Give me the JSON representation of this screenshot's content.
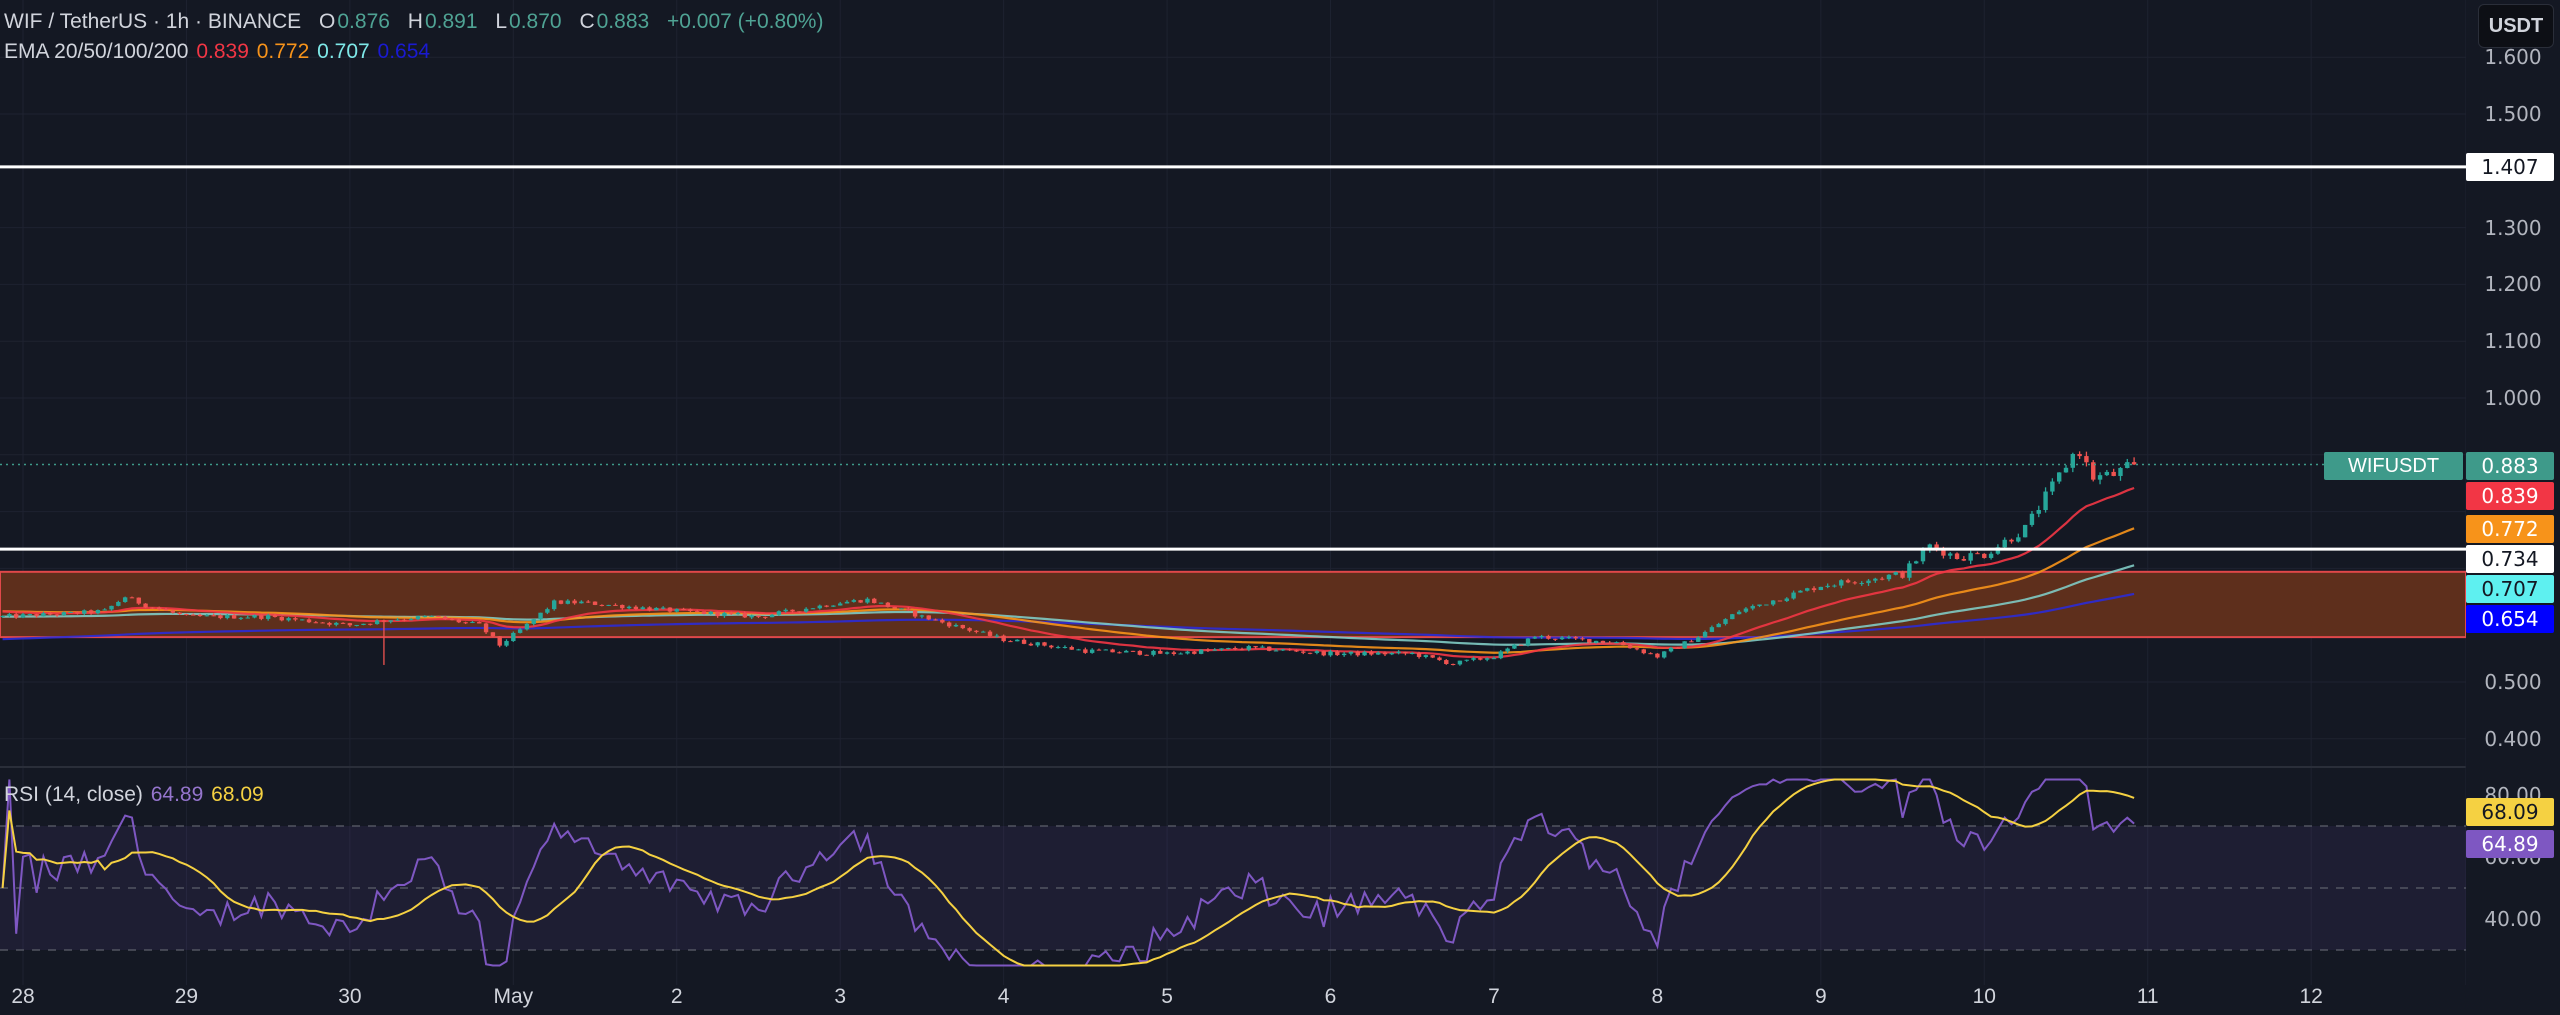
{
  "header": {
    "symbol": "WIF / TetherUS · 1h · BINANCE",
    "o_label": "O",
    "o": "0.876",
    "h_label": "H",
    "h": "0.891",
    "l_label": "L",
    "l": "0.870",
    "c_label": "C",
    "c": "0.883",
    "change": "+0.007 (+0.80%)"
  },
  "ema_legend": {
    "label": "EMA 20/50/100/200",
    "v20": "0.839",
    "v50": "0.772",
    "v100": "0.707",
    "v200": "0.654"
  },
  "rsi_legend": {
    "label": "RSI (14, close)",
    "rsi": "64.89",
    "ma": "68.09"
  },
  "currency_button": "USDT",
  "price_axis": {
    "ticks": [
      "1.600",
      "1.500",
      "1.300",
      "1.200",
      "1.100",
      "1.000",
      "0.500",
      "0.400"
    ]
  },
  "rsi_axis": {
    "ticks": [
      "80.00",
      "60.00",
      "40.00"
    ]
  },
  "price_labels": {
    "symbol": "WIFUSDT",
    "last": "0.883",
    "ema20": "0.839",
    "ema50": "0.772",
    "level_low": "0.734",
    "ema100": "0.707",
    "ema200": "0.654",
    "level_high": "1.407"
  },
  "rsi_labels": {
    "ma": "68.09",
    "rsi": "64.89"
  },
  "time_axis": [
    {
      "label": "28",
      "hour": 0
    },
    {
      "label": "29",
      "hour": 24
    },
    {
      "label": "30",
      "hour": 48
    },
    {
      "label": "May",
      "hour": 72
    },
    {
      "label": "2",
      "hour": 96
    },
    {
      "label": "3",
      "hour": 120
    },
    {
      "label": "4",
      "hour": 144
    },
    {
      "label": "5",
      "hour": 168
    },
    {
      "label": "6",
      "hour": 192
    },
    {
      "label": "7",
      "hour": 216
    },
    {
      "label": "8",
      "hour": 240
    },
    {
      "label": "9",
      "hour": 264
    },
    {
      "label": "10",
      "hour": 288
    },
    {
      "label": "11",
      "hour": 312
    },
    {
      "label": "12",
      "hour": 336
    }
  ],
  "chart_data": {
    "type": "candlestick",
    "title": "WIF / TetherUS · 1h · BINANCE",
    "x_unit": "hours since Apr 28 00:00",
    "x_range": [
      -3,
      334
    ],
    "ylim": [
      0.36,
      1.63
    ],
    "close_waypoints": [
      [
        -3,
        0.615
      ],
      [
        6,
        0.62
      ],
      [
        12,
        0.625
      ],
      [
        15,
        0.65
      ],
      [
        18,
        0.635
      ],
      [
        24,
        0.615
      ],
      [
        36,
        0.615
      ],
      [
        48,
        0.6
      ],
      [
        54,
        0.61
      ],
      [
        60,
        0.615
      ],
      [
        67,
        0.6
      ],
      [
        70,
        0.565
      ],
      [
        74,
        0.6
      ],
      [
        78,
        0.64
      ],
      [
        82,
        0.64
      ],
      [
        96,
        0.625
      ],
      [
        108,
        0.615
      ],
      [
        120,
        0.64
      ],
      [
        124,
        0.645
      ],
      [
        132,
        0.615
      ],
      [
        144,
        0.575
      ],
      [
        156,
        0.555
      ],
      [
        168,
        0.55
      ],
      [
        180,
        0.56
      ],
      [
        192,
        0.55
      ],
      [
        204,
        0.55
      ],
      [
        210,
        0.532
      ],
      [
        216,
        0.545
      ],
      [
        222,
        0.58
      ],
      [
        234,
        0.57
      ],
      [
        240,
        0.545
      ],
      [
        246,
        0.58
      ],
      [
        252,
        0.625
      ],
      [
        264,
        0.67
      ],
      [
        276,
        0.69
      ],
      [
        280,
        0.74
      ],
      [
        284,
        0.72
      ],
      [
        288,
        0.725
      ],
      [
        294,
        0.77
      ],
      [
        298,
        0.845
      ],
      [
        301,
        0.9
      ],
      [
        302,
        0.905
      ],
      [
        304,
        0.86
      ],
      [
        307,
        0.865
      ],
      [
        310,
        0.883
      ]
    ],
    "special_wicks": [
      {
        "hour": 53,
        "low": 0.53
      }
    ],
    "levels": [
      1.407,
      0.734
    ],
    "zone": [
      0.579,
      0.694
    ],
    "ema_periods": [
      20,
      50,
      100,
      200
    ],
    "ema_seed": [
      0.625,
      0.625,
      0.615,
      0.575
    ],
    "ema_last": [
      0.839,
      0.772,
      0.707,
      0.654
    ],
    "last_price": 0.883,
    "rsi": {
      "period": 14,
      "ma_period": 14,
      "upper": 70,
      "lower": 30,
      "ylim": [
        25,
        85
      ],
      "last": 64.89,
      "ma_last": 68.09
    },
    "colors": {
      "up": "#26a69a",
      "down": "#ef5350",
      "ema20": "#f23645",
      "ema50": "#f7931a",
      "ema100": "#80cbc4",
      "ema200": "#2b2bd6",
      "rsi": "#7e57c2",
      "rsi_ma": "#f5d142",
      "zone": "#5e2f1c",
      "zone_border": "#e0484a"
    }
  }
}
